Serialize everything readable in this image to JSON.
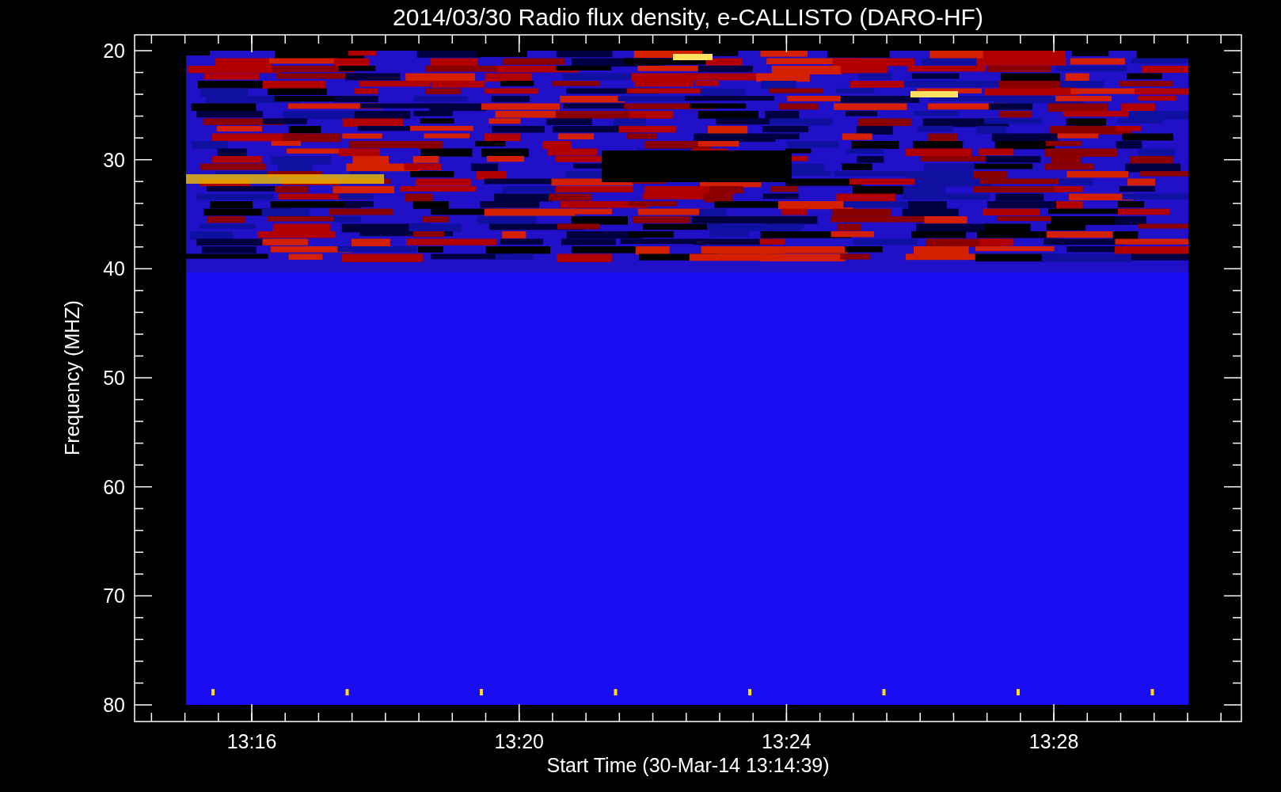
{
  "title": "2014/03/30  Radio flux density, e-CALLISTO (DARO-HF)",
  "ylabel": "Frequency (MHZ)",
  "xlabel": "Start Time (30-Mar-14 13:14:39)",
  "yticks": [
    "20",
    "30",
    "40",
    "50",
    "60",
    "70",
    "80"
  ],
  "xticks": [
    "13:16",
    "13:20",
    "13:24",
    "13:28"
  ]
}
